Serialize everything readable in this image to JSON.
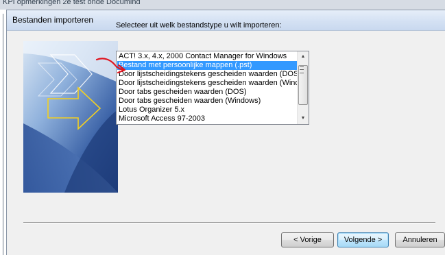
{
  "background_window": {
    "caption": "KPI opmerkingen 2e test onde Documind"
  },
  "dialog": {
    "title": "Bestanden importeren",
    "prompt": "Selecteer uit welk bestandstype u wilt importeren:",
    "file_types": [
      "ACT! 3.x, 4.x, 2000 Contact Manager for Windows",
      "Bestand met persoonlijke mappen (.pst)",
      "Door lijstscheidingstekens gescheiden waarden (DOS)",
      "Door lijstscheidingstekens gescheiden waarden (Windows)",
      "Door tabs gescheiden waarden (DOS)",
      "Door tabs gescheiden waarden (Windows)",
      "Lotus Organizer 5.x",
      "Microsoft Access 97-2003"
    ],
    "selected_index": 1,
    "buttons": {
      "back": "< Vorige",
      "next": "Volgende >",
      "cancel": "Annuleren"
    },
    "scrollbar": {
      "up_icon": "scroll-up-arrow",
      "down_icon": "scroll-down-arrow"
    }
  },
  "colors": {
    "selection": "#3399ff",
    "title_bar": "#d4e1f3",
    "dialog_bg": "#f0f0f0",
    "art_blue": "#2c4f91",
    "arrow_yellow": "#f4d020",
    "annotation_red": "#e0141e"
  }
}
